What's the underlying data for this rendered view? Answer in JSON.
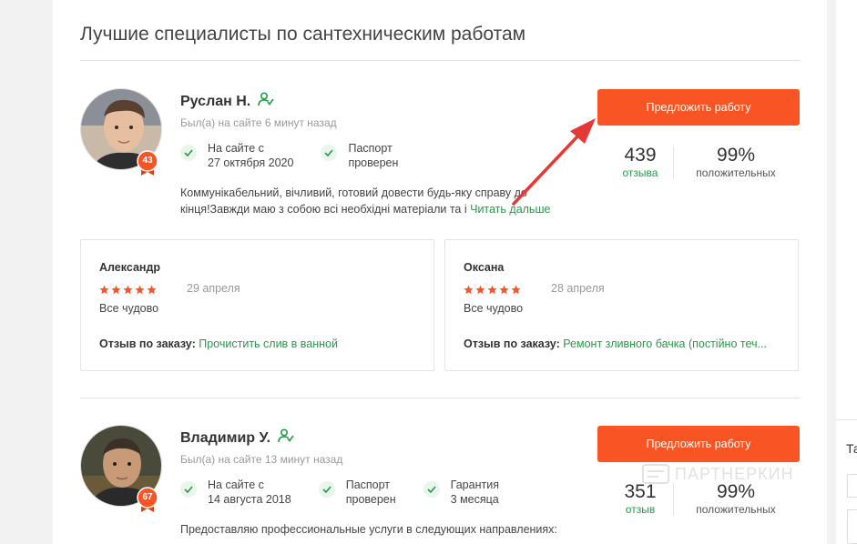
{
  "page": {
    "title": "Лучшие специалисты по сантехническим работам"
  },
  "specialists": [
    {
      "name": "Руслан Н.",
      "online": "Был(а) на сайте 6 минут назад",
      "badge": "43",
      "facts": [
        {
          "line1": "На сайте с",
          "line2": "27 октября 2020"
        },
        {
          "line1": "Паспорт",
          "line2": "проверен"
        }
      ],
      "description": "Коммунікабельний, вічливий, готовий довести будь-яку справу до кінця!Завжди маю з собою всі необхідні матеріали та і",
      "read_more": "Читать дальше",
      "offer_button": "Предложить работу",
      "reviews_count": "439",
      "reviews_label": "отзыва",
      "positive_percent": "99%",
      "positive_label": "положительных"
    },
    {
      "name": "Владимир У.",
      "online": "Был(а) на сайте 13 минут назад",
      "badge": "67",
      "facts": [
        {
          "line1": "На сайте с",
          "line2": "14 августа 2018"
        },
        {
          "line1": "Паспорт",
          "line2": "проверен"
        },
        {
          "line1": "Гарантия",
          "line2": "3 месяца"
        }
      ],
      "description": "Предоставляю профессиональные услуги в следующих направлениях:",
      "offer_button": "Предложить работу",
      "reviews_count": "351",
      "reviews_label": "отзыв",
      "positive_percent": "99%",
      "positive_label": "положительных"
    }
  ],
  "reviews": [
    {
      "author": "Александр",
      "stars": 5,
      "date": "29 апреля",
      "text": "Все чудово",
      "order_label": "Отзыв по заказу:",
      "order_link": "Прочистить слив в ванной"
    },
    {
      "author": "Оксана",
      "stars": 5,
      "date": "28 апреля",
      "text": "Все чудово",
      "order_label": "Отзыв по заказу:",
      "order_link": "Ремонт зливного бачка (постійно теч..."
    }
  ],
  "watermark": "ПАРТНЕРКИН",
  "right_column": {
    "text": "Та"
  },
  "colors": {
    "accent": "#f95524",
    "green": "#26994b",
    "annotation_arrow": "#e53935"
  },
  "icons": {
    "verified": "user-check-icon",
    "check": "check-icon",
    "star": "star-icon"
  }
}
